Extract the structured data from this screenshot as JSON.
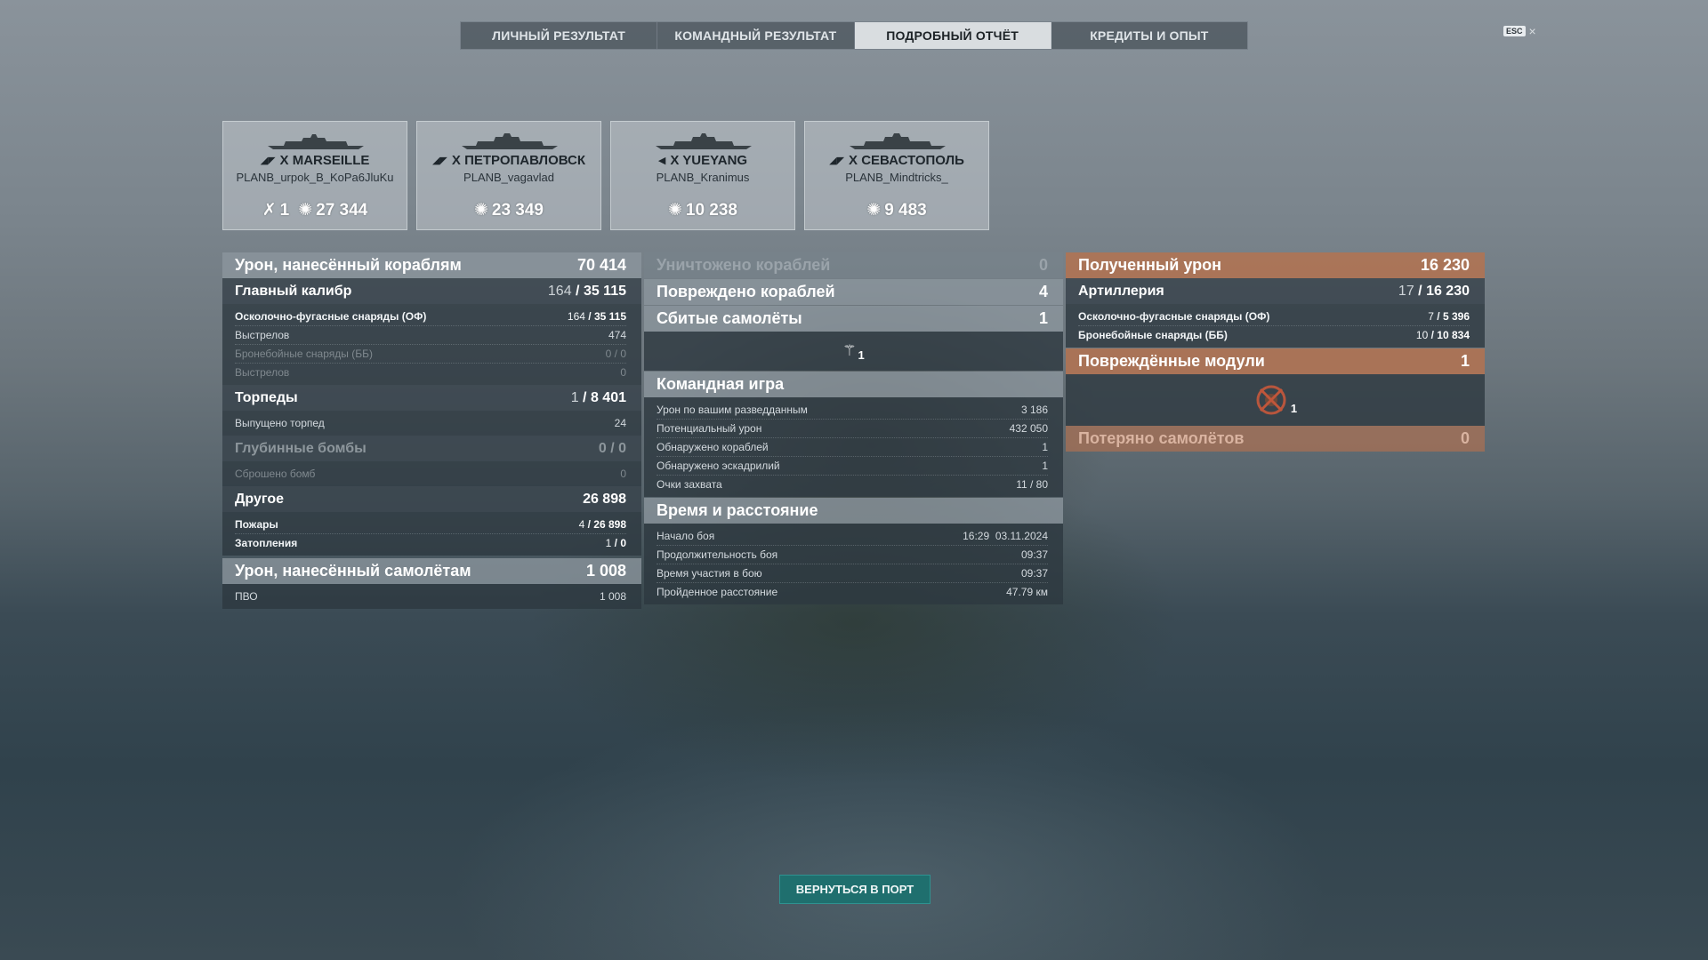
{
  "tabs": [
    "ЛИЧНЫЙ РЕЗУЛЬТАТ",
    "КОМАНДНЫЙ РЕЗУЛЬТАТ",
    "ПОДРОБНЫЙ ОТЧЁТ",
    "КРЕДИТЫ И ОПЫТ"
  ],
  "active_tab": "ПОДРОБНЫЙ ОТЧЁТ",
  "esc": {
    "key": "ESC",
    "close": "×"
  },
  "ships": [
    {
      "name": "X MARSEILLE",
      "player": "PLANB_urpok_B_KoPa6JluKu",
      "kills": "1",
      "damage": "27 344"
    },
    {
      "name": "X ПЕТРОПАВЛОВСК",
      "player": "PLANB_vagavlad",
      "damage": "23 349"
    },
    {
      "name": "X YUEYANG",
      "player": "PLANB_Kranimus",
      "damage": "10 238"
    },
    {
      "name": "X СЕВАСТОПОЛЬ",
      "player": "PLANB_Mindtricks_",
      "damage": "9 483"
    }
  ],
  "left": {
    "ship_damage": {
      "label": "Урон, нанесённый кораблям",
      "value": "70 414"
    },
    "main_battery": {
      "label": "Главный калибр",
      "value_a": "164",
      "value_b": "35 115"
    },
    "he": {
      "label": "Осколочно-фугасные снаряды (ОФ)",
      "value_a": "164",
      "value_b": "35 115"
    },
    "he_shots": {
      "label": "Выстрелов",
      "value": "474"
    },
    "ap": {
      "label": "Бронебойные снаряды (ББ)",
      "value": "0 / 0"
    },
    "ap_shots": {
      "label": "Выстрелов",
      "value": "0"
    },
    "torpedoes": {
      "label": "Торпеды",
      "value_a": "1",
      "value_b": "8 401"
    },
    "torps_launched": {
      "label": "Выпущено торпед",
      "value": "24"
    },
    "depth": {
      "label": "Глубинные бомбы",
      "value": "0 / 0"
    },
    "depth_dropped": {
      "label": "Сброшено бомб",
      "value": "0"
    },
    "other": {
      "label": "Другое",
      "value": "26 898"
    },
    "fires": {
      "label": "Пожары",
      "value_a": "4",
      "value_b": "26 898"
    },
    "floods": {
      "label": "Затопления",
      "value_a": "1",
      "value_b": "0"
    },
    "plane_damage": {
      "label": "Урон, нанесённый самолётам",
      "value": "1 008"
    },
    "aa": {
      "label": "ПВО",
      "value": "1 008"
    }
  },
  "middle": {
    "destroyed": {
      "label": "Уничтожено кораблей",
      "value": "0"
    },
    "damaged": {
      "label": "Повреждено кораблей",
      "value": "4"
    },
    "planes_shot": {
      "label": "Сбитые самолёты",
      "value": "1"
    },
    "planes_icon_count": "1",
    "team": {
      "label": "Командная игра"
    },
    "spotting_dmg": {
      "label": "Урон по вашим разведданным",
      "value": "3 186"
    },
    "potential_dmg": {
      "label": "Потенциальный урон",
      "value": "432 050"
    },
    "ships_spotted": {
      "label": "Обнаружено кораблей",
      "value": "1"
    },
    "squadrons_spotted": {
      "label": "Обнаружено эскадрилий",
      "value": "1"
    },
    "capture": {
      "label": "Очки захвата",
      "value": "11 / 80"
    },
    "time": {
      "label": "Время и расстояние"
    },
    "start": {
      "label": "Начало боя",
      "value": "16:29  03.11.2024"
    },
    "duration": {
      "label": "Продолжительность боя",
      "value": "09:37"
    },
    "participation": {
      "label": "Время участия в бою",
      "value": "09:37"
    },
    "distance": {
      "label": "Пройденное расстояние",
      "value": "47.79 км"
    }
  },
  "right": {
    "received": {
      "label": "Полученный урон",
      "value": "16 230"
    },
    "artillery": {
      "label": "Артиллерия",
      "value_a": "17",
      "value_b": "16 230"
    },
    "he": {
      "label": "Осколочно-фугасные снаряды (ОФ)",
      "value_a": "7",
      "value_b": "5 396"
    },
    "ap": {
      "label": "Бронебойные снаряды (ББ)",
      "value_a": "10",
      "value_b": "10 834"
    },
    "modules": {
      "label": "Повреждённые модули",
      "value": "1"
    },
    "module_icon_count": "1",
    "planes_lost": {
      "label": "Потеряно самолётов",
      "value": "0"
    }
  },
  "port_button": "ВЕРНУТЬСЯ В ПОРТ",
  "colors": {
    "accent_orange": "#b27352",
    "button_teal": "#1f6f6e",
    "active_tab": "#d9dde0"
  }
}
